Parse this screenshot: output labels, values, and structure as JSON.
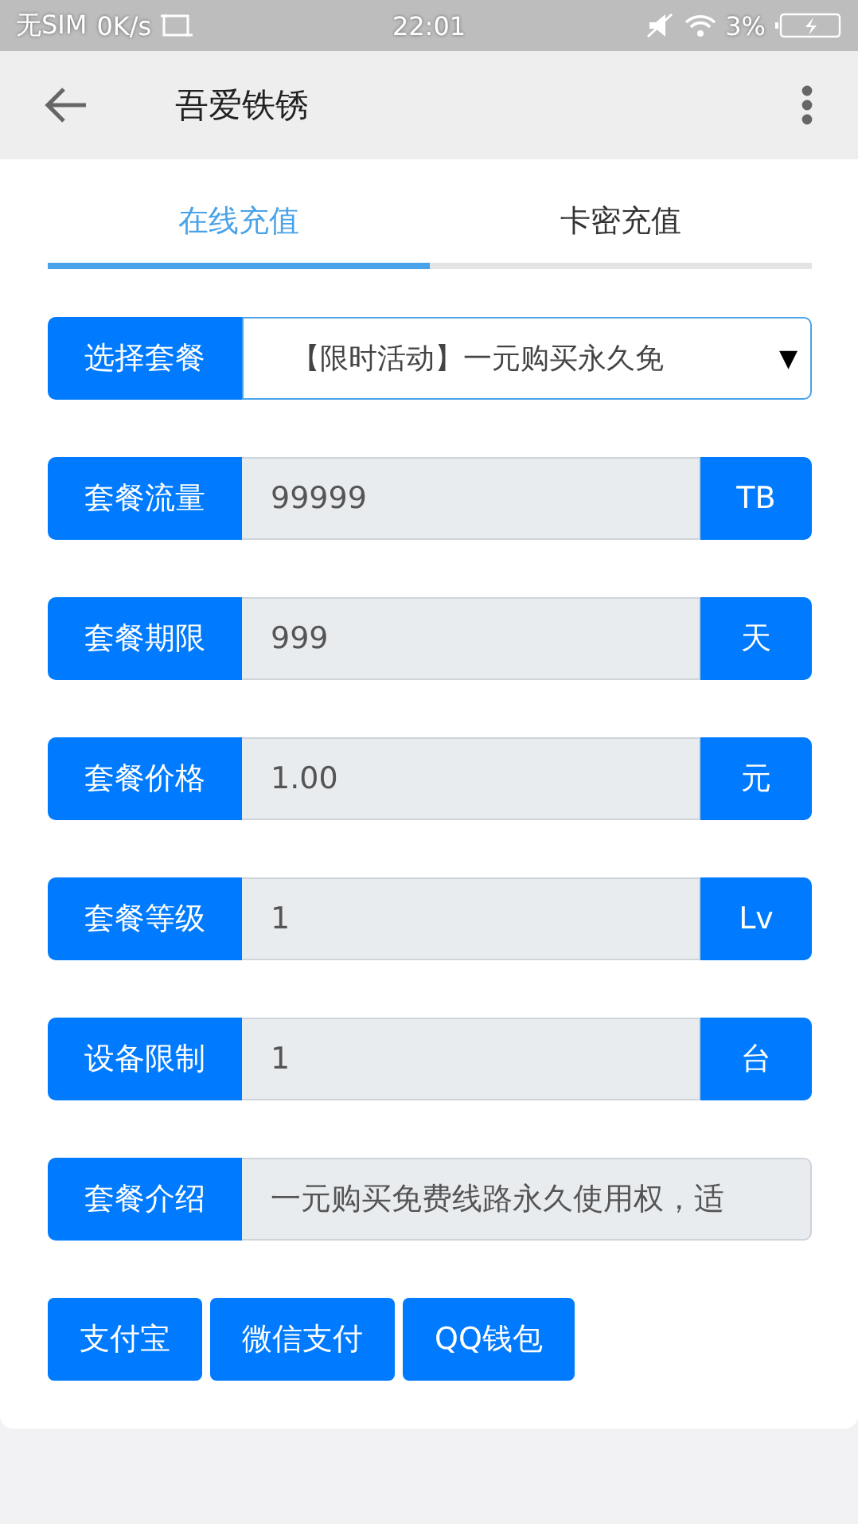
{
  "status_bar": {
    "carrier": "无SIM",
    "speed": "0K/s",
    "time": "22:01",
    "battery": "3%"
  },
  "toolbar": {
    "title": "吾爱铁锈"
  },
  "tabs": [
    {
      "label": "在线充值",
      "selected": true
    },
    {
      "label": "卡密充值",
      "selected": false
    }
  ],
  "form_rows": [
    {
      "kind": "select",
      "label": "选择套餐",
      "value": "【限时活动】一元购买永久免",
      "arrow": "▼"
    },
    {
      "kind": "addon",
      "label": "套餐流量",
      "value": "99999",
      "unit": "TB"
    },
    {
      "kind": "addon",
      "label": "套餐期限",
      "value": "999",
      "unit": "天"
    },
    {
      "kind": "addon",
      "label": "套餐价格",
      "value": "1.00",
      "unit": "元"
    },
    {
      "kind": "addon",
      "label": "套餐等级",
      "value": "1",
      "unit": "Lv"
    },
    {
      "kind": "addon",
      "label": "设备限制",
      "value": "1",
      "unit": "台"
    },
    {
      "kind": "text",
      "label": "套餐介绍",
      "value": "一元购买免费线路永久使用权，适"
    }
  ],
  "pay_buttons": [
    "支付宝",
    "微信支付",
    "QQ钱包"
  ]
}
